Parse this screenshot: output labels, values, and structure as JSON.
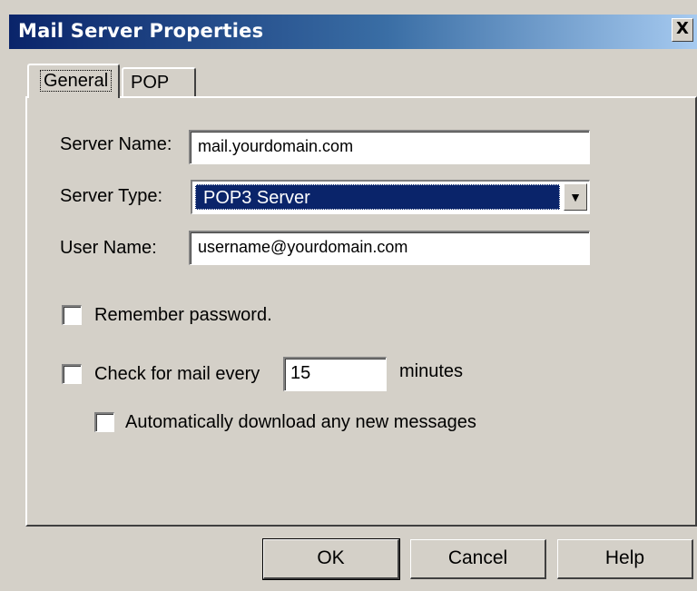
{
  "window": {
    "title": "Mail Server Properties",
    "close_glyph": "X"
  },
  "tabs": [
    {
      "label": "General",
      "active": true
    },
    {
      "label": "POP",
      "active": false
    }
  ],
  "form": {
    "server_name": {
      "label": "Server Name:",
      "value": "mail.yourdomain.com"
    },
    "server_type": {
      "label": "Server Type:",
      "value": "POP3 Server",
      "arrow_glyph": "▼"
    },
    "user_name": {
      "label": "User Name:",
      "value": "username@yourdomain.com"
    },
    "remember_password": {
      "label": "Remember password.",
      "checked": false
    },
    "check_mail": {
      "label": "Check for mail every",
      "interval": "15",
      "unit": "minutes",
      "checked": false
    },
    "auto_download": {
      "label": "Automatically download any new messages",
      "checked": false
    }
  },
  "buttons": {
    "ok": "OK",
    "cancel": "Cancel",
    "help": "Help"
  },
  "colors": {
    "titlebar_start": "#0a246a",
    "titlebar_end": "#a6caf0",
    "dialog_face": "#d4d0c8",
    "selection": "#0a246a"
  }
}
